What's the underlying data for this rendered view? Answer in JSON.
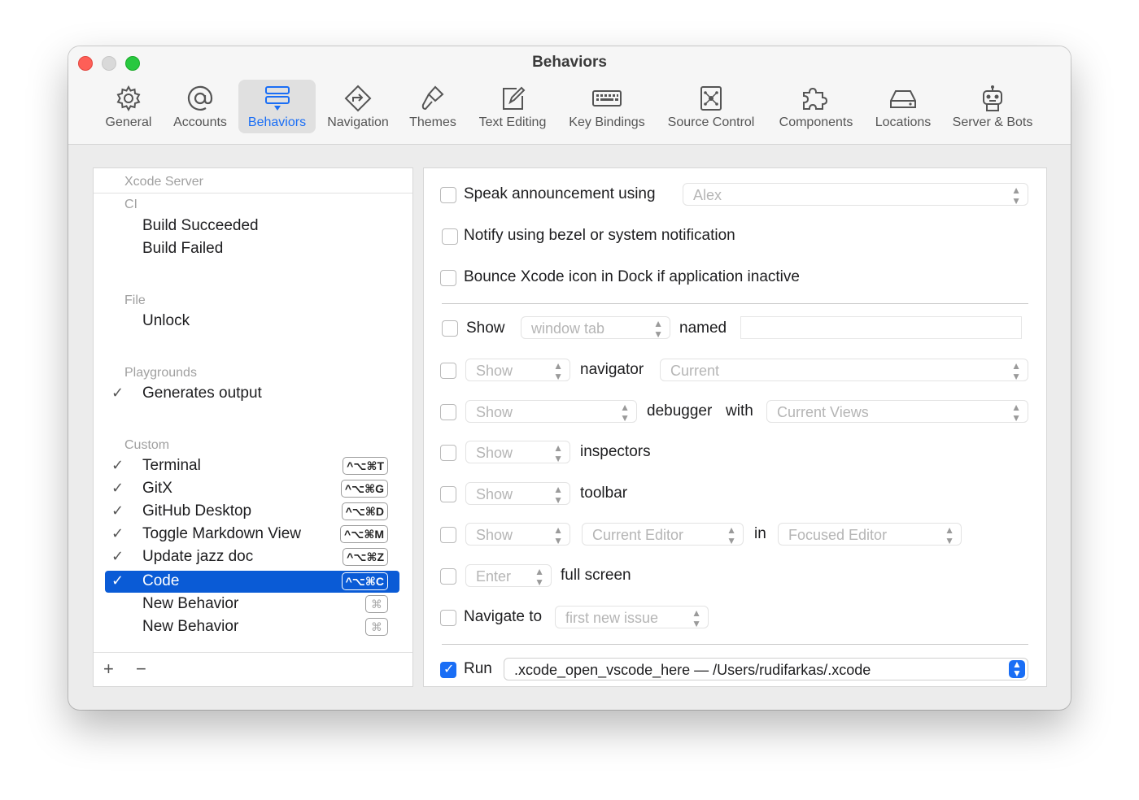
{
  "window": {
    "title": "Behaviors"
  },
  "toolbar": [
    {
      "label": "General",
      "icon": "gear-icon"
    },
    {
      "label": "Accounts",
      "icon": "at-icon"
    },
    {
      "label": "Behaviors",
      "icon": "behaviors-icon",
      "selected": true
    },
    {
      "label": "Navigation",
      "icon": "navigation-icon"
    },
    {
      "label": "Themes",
      "icon": "brush-icon"
    },
    {
      "label": "Text Editing",
      "icon": "pencil-square-icon"
    },
    {
      "label": "Key Bindings",
      "icon": "keyboard-icon"
    },
    {
      "label": "Source Control",
      "icon": "source-control-icon"
    },
    {
      "label": "Components",
      "icon": "puzzle-icon"
    },
    {
      "label": "Locations",
      "icon": "disk-icon"
    },
    {
      "label": "Server & Bots",
      "icon": "robot-icon"
    }
  ],
  "sidebar": {
    "groups": [
      {
        "header": "Xcode Server"
      },
      {
        "header": "CI",
        "items": [
          {
            "label": "Build Succeeded"
          },
          {
            "label": "Build Failed"
          }
        ]
      },
      {
        "header": "File",
        "items": [
          {
            "label": "Unlock"
          }
        ]
      },
      {
        "header": "Playgrounds",
        "items": [
          {
            "label": "Generates output",
            "checked": "✓"
          }
        ]
      },
      {
        "header": "Custom",
        "items": [
          {
            "label": "Terminal",
            "checked": "✓",
            "shortcut": "^⌥⌘T"
          },
          {
            "label": "GitX",
            "checked": "✓",
            "shortcut": "^⌥⌘G"
          },
          {
            "label": "GitHub Desktop",
            "checked": "✓",
            "shortcut": "^⌥⌘D"
          },
          {
            "label": "Toggle Markdown View",
            "checked": "✓",
            "shortcut": "^⌥⌘M"
          },
          {
            "label": "Update jazz doc",
            "checked": "✓",
            "shortcut": "^⌥⌘Z"
          },
          {
            "label": "Code",
            "checked": "✓",
            "shortcut": "^⌥⌘C",
            "selected": true
          },
          {
            "label": "New Behavior",
            "shortcut": "⌘"
          },
          {
            "label": "New Behavior",
            "shortcut": "⌘"
          }
        ]
      }
    ],
    "add_label": "+",
    "remove_label": "−"
  },
  "settings": {
    "speak": {
      "label": "Speak announcement using",
      "voice": "Alex"
    },
    "notify": {
      "label": "Notify using bezel or system notification"
    },
    "bounce": {
      "label": "Bounce Xcode icon in Dock if application inactive"
    },
    "show_tab": {
      "show": "Show",
      "tab_value": "window tab",
      "named": "named",
      "name_value": ""
    },
    "navigator": {
      "show_value": "Show",
      "label": "navigator",
      "value": "Current"
    },
    "debugger": {
      "show_value": "Show",
      "label": "debugger",
      "with": "with",
      "value": "Current Views"
    },
    "inspectors": {
      "show_value": "Show",
      "label": "inspectors"
    },
    "toolbar": {
      "show_value": "Show",
      "label": "toolbar"
    },
    "editor": {
      "show_value": "Show",
      "editor_value": "Current Editor",
      "in": "in",
      "target_value": "Focused Editor"
    },
    "fullscreen": {
      "value": "Enter",
      "label": "full screen"
    },
    "navigate": {
      "label": "Navigate to",
      "value": "first new issue"
    },
    "run": {
      "label": "Run",
      "checked": true,
      "value": ".xcode_open_vscode_here — /Users/rudifarkas/.xcode"
    }
  }
}
